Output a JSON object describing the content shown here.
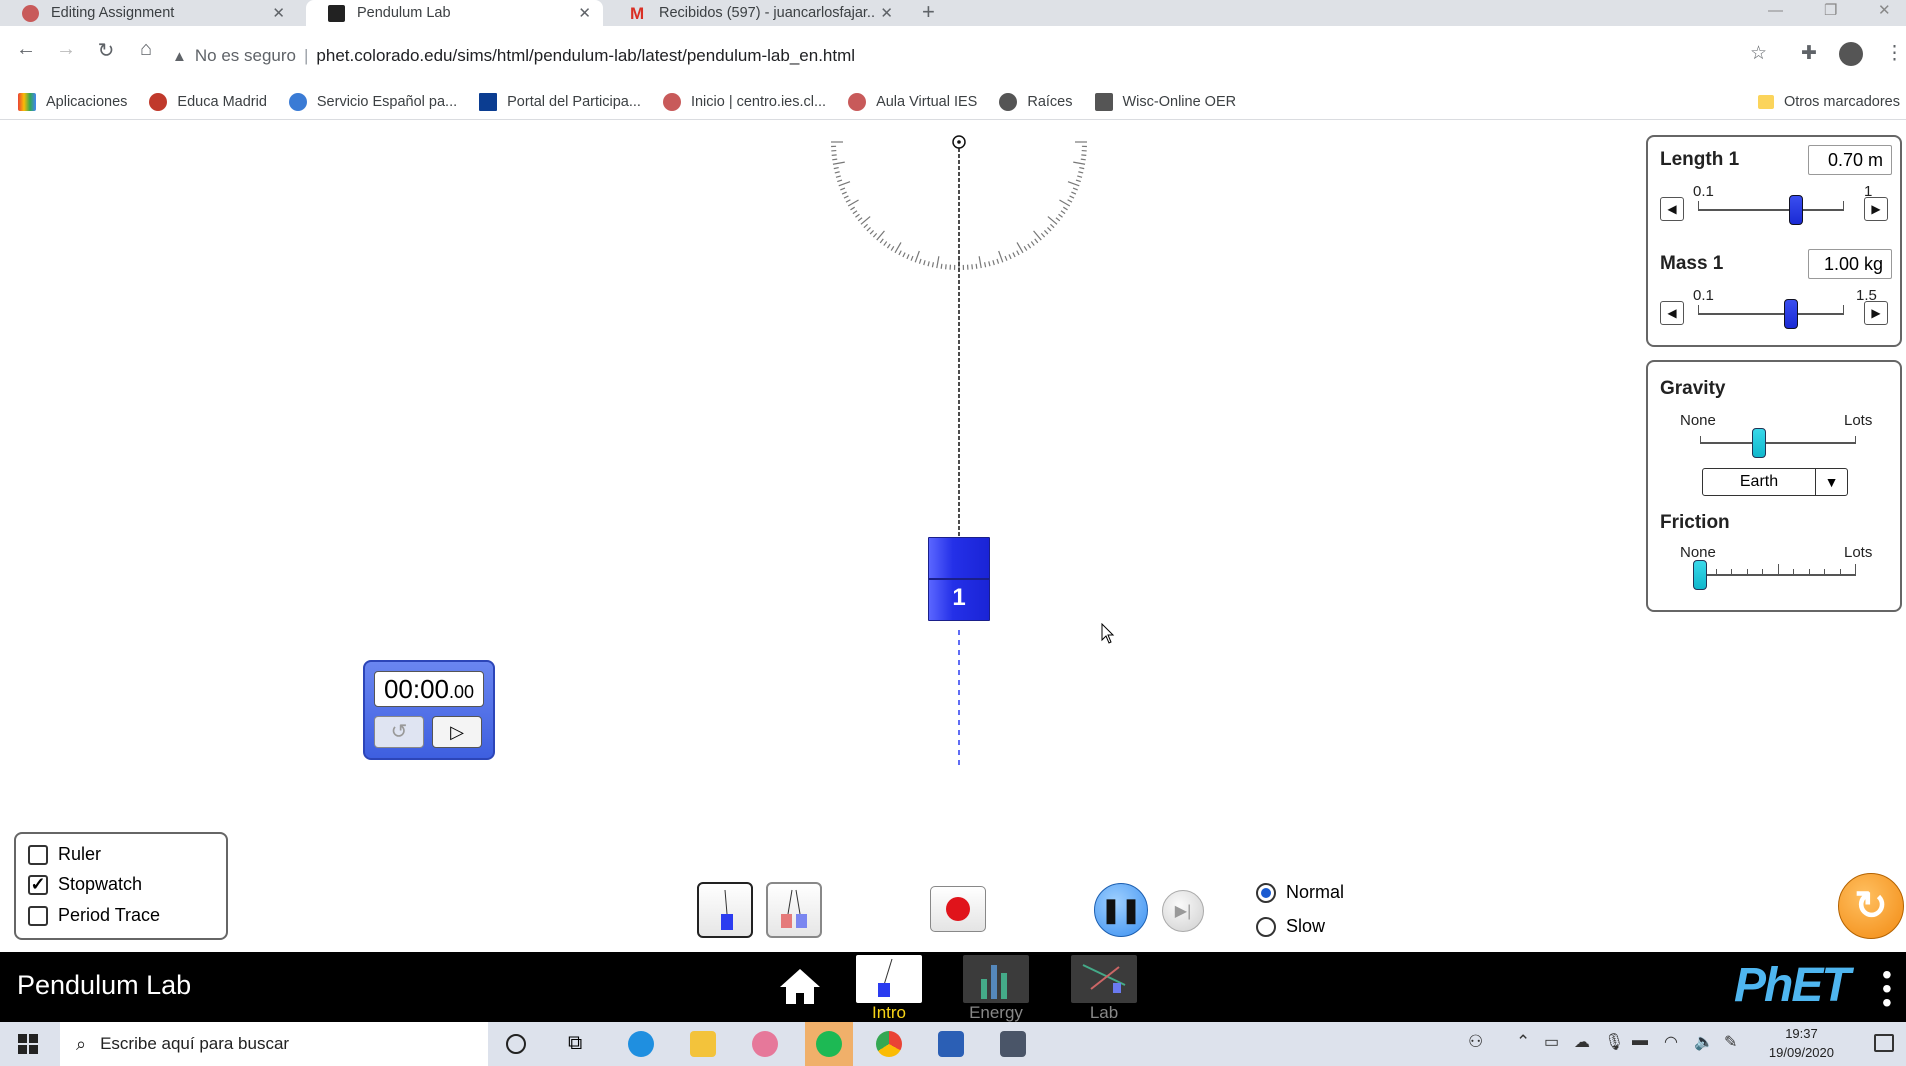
{
  "browser": {
    "tabs": [
      {
        "title": "Editing Assignment",
        "favicon_color": "#c85a5a"
      },
      {
        "title": "Pendulum Lab",
        "favicon_color": "#222222"
      },
      {
        "title": "Recibidos (597) - juancarlosfajar...",
        "favicon_color": "#d93025"
      }
    ],
    "address": {
      "security": "No es seguro",
      "url": "phet.colorado.edu/sims/html/pendulum-lab/latest/pendulum-lab_en.html"
    },
    "bookmarks": [
      "Aplicaciones",
      "Educa Madrid",
      "Servicio Español pa...",
      "Portal del Participa...",
      "Inicio | centro.ies.cl...",
      "Aula Virtual IES",
      "Raíces",
      "Wisc-Online OER"
    ],
    "other_bookmarks": "Otros marcadores"
  },
  "sim": {
    "title": "Pendulum Lab",
    "length": {
      "label": "Length 1",
      "value": "0.70 m",
      "min": "0.1",
      "max": "1",
      "fraction": 0.67
    },
    "mass": {
      "label": "Mass 1",
      "value": "1.00 kg",
      "min": "0.1",
      "max": "1.5",
      "fraction": 0.64
    },
    "gravity": {
      "label": "Gravity",
      "min": "None",
      "max": "Lots",
      "planet": "Earth",
      "fraction": 0.38
    },
    "friction": {
      "label": "Friction",
      "min": "None",
      "max": "Lots",
      "fraction": 0.0
    },
    "pendulum": {
      "number": "1"
    },
    "stopwatch": {
      "time_main": "00:00",
      "time_fraction": ".00"
    },
    "checkboxes": [
      {
        "label": "Ruler",
        "checked": false
      },
      {
        "label": "Stopwatch",
        "checked": true
      },
      {
        "label": "Period Trace",
        "checked": false
      }
    ],
    "speed": {
      "normal": "Normal",
      "slow": "Slow",
      "selected": "Normal"
    },
    "screens": [
      {
        "label": "Intro",
        "active": true
      },
      {
        "label": "Energy",
        "active": false
      },
      {
        "label": "Lab",
        "active": false
      }
    ],
    "logo": "PhET"
  },
  "taskbar": {
    "search_placeholder": "Escribe aquí para buscar",
    "time": "19:37",
    "date": "19/09/2020"
  },
  "colors": {
    "mass_blue": "#2f3ef5",
    "accent_cyan": "#19c3d6",
    "sim_bar": "#000000",
    "intro_label": "#f7d417"
  }
}
